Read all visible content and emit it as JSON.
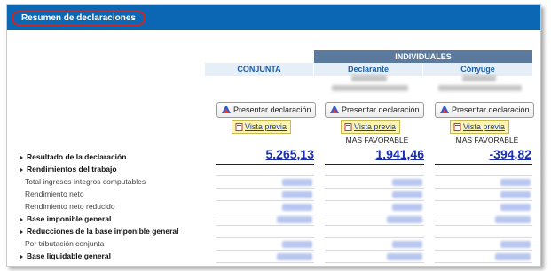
{
  "header": {
    "title": "Resumen de declaraciones"
  },
  "columns": {
    "band_label": "INDIVIDUALES",
    "conjunta": "CONJUNTA",
    "declarante": "Declarante",
    "conyuge": "Cónyuge"
  },
  "buttons": {
    "present_label": "Presentar declaración",
    "preview_label": "Vista previa",
    "mas_favorable": "MAS FAVORABLE"
  },
  "results": {
    "label": "Resultado de la declaración",
    "conjunta": "5.265,13",
    "declarante": "1.941,46",
    "conyuge": "-394,82"
  },
  "rows": [
    {
      "label": "Rendimientos del trabajo",
      "style": "bold"
    },
    {
      "label": "Total ingresos íntegros computables",
      "style": "sub"
    },
    {
      "label": "Rendimiento neto",
      "style": "sub"
    },
    {
      "label": "Rendimiento neto reducido",
      "style": "sub"
    },
    {
      "label": "Base imponible general",
      "style": "bold"
    },
    {
      "label": "Reducciones de la base imponible general",
      "style": "bold"
    },
    {
      "label": "Por tributación conjunta",
      "style": "sub"
    },
    {
      "label": "Base liquidable general",
      "style": "bold"
    }
  ],
  "icons": {
    "section": "section-arrow-icon",
    "present": "sign-pen-icon",
    "preview": "document-preview-icon"
  },
  "colors": {
    "header_bg": "#0b67b3",
    "band_bg": "#5b7a9e",
    "link": "#1a2fb0",
    "highlight": "#c62828"
  }
}
